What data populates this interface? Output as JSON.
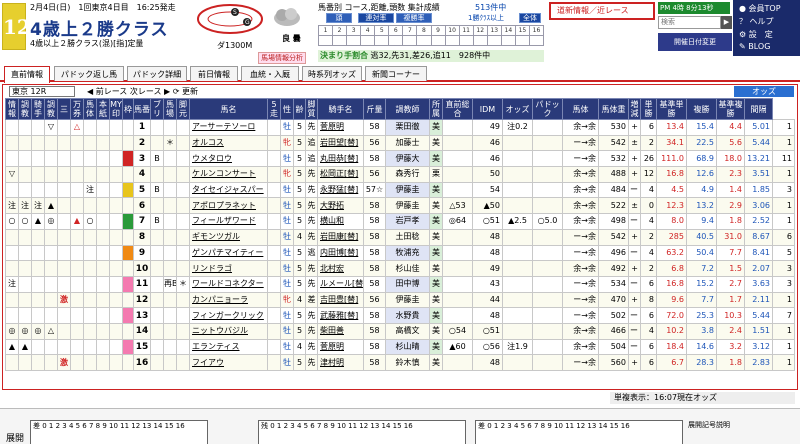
{
  "header": {
    "race_no": "12",
    "date_line": "2月4日(日)　1回東京4日目　16:25発走",
    "race_name": "4歳上２勝クラス",
    "conditions": "4歳以上２勝クラス(混)[指]定量",
    "distance": "ダ1300M",
    "weather": "良 曇",
    "bagen_btn": "馬場情報分析",
    "course_title": "馬番別 コース,距離,頭数 集計成績",
    "count_top": "513件中",
    "tag_a": "頭",
    "tag_b": "連対率",
    "tag_c": "複勝率",
    "one_sel": "1勝ｸﾗｽ以上",
    "all_sel": "全体",
    "kimari": "決まり手割合",
    "kimari_vals": "逃32,先31,差26,追11　928件中",
    "news": "道新情報／近レース",
    "pm": "PM 4時 8分13秒",
    "search_placeholder": "検索",
    "kaisai": "開催日付変更",
    "menu": [
      "会員TOP",
      "ヘルプ",
      "設　定",
      "BLOG"
    ]
  },
  "tabs": [
    "直前情報",
    "パドック返し馬",
    "パドック詳細",
    "前日情報",
    "血統・入厩",
    "時系列オッズ",
    "新聞コーナー"
  ],
  "subbar": {
    "course": "東京 12R",
    "prev": "前レース",
    "next": "次レース",
    "refresh": "更新",
    "odds": "オッズ"
  },
  "columns": [
    "情報",
    "調教",
    "騎手",
    "調教",
    "三",
    "万券",
    "馬体",
    "本紙",
    "MY印",
    "枠",
    "馬番",
    "ブリ",
    "馬場",
    "脚元",
    "馬名",
    "5走",
    "性",
    "齢",
    "脚質",
    "騎手名",
    "斤量",
    "調教師",
    "所属",
    "直前総合",
    "IDM",
    "オッズ",
    "パドック",
    "馬体",
    "馬体重",
    "増減",
    "単勝",
    "基準単勝",
    "複勝",
    "基準複勝",
    "間隔"
  ],
  "rows": [
    {
      "c": [
        "",
        "",
        "",
        "▽",
        "",
        "△",
        "",
        "",
        "",
        "1",
        "1",
        "",
        "",
        "",
        "アーサーテソーロ",
        "",
        "牡",
        "5",
        "先",
        "菅原明",
        "58",
        "栗田徹",
        "美",
        "",
        "49",
        "注0.2",
        "",
        "余→余",
        "530",
        "+",
        "6",
        "13.4",
        "15.4",
        "4.4",
        "5.01",
        "1"
      ]
    },
    {
      "c": [
        "",
        "",
        "",
        "",
        "",
        "",
        "",
        "",
        "",
        "2",
        "2",
        "",
        "＊",
        "",
        "オルコス",
        "",
        "牝",
        "5",
        "追",
        "岩田望[替]",
        "56",
        "加藤士",
        "美",
        "",
        "46",
        "",
        "",
        "ー→余",
        "542",
        "±",
        "2",
        "34.1",
        "22.5",
        "5.6",
        "5.44",
        "1"
      ]
    },
    {
      "c": [
        "",
        "",
        "",
        "",
        "",
        "",
        "",
        "",
        "",
        "3",
        "3",
        "B",
        "",
        "",
        "ウメタロウ",
        "",
        "牡",
        "5",
        "追",
        "丸田恭[替]",
        "58",
        "伊藤大",
        "美",
        "",
        "46",
        "",
        "",
        "ー→余",
        "532",
        "+",
        "26",
        "111.0",
        "68.9",
        "18.0",
        "13.21",
        "11"
      ]
    },
    {
      "c": [
        "▽",
        "",
        "",
        "",
        "",
        "",
        "",
        "",
        "",
        "4",
        "4",
        "",
        "",
        "",
        "ケルンコンサート",
        "",
        "牝",
        "5",
        "先",
        "松岡正[替]",
        "56",
        "森秀行",
        "栗",
        "",
        "50",
        "",
        "",
        "余→余",
        "488",
        "+",
        "12",
        "16.8",
        "12.6",
        "2.3",
        "3.51",
        "1"
      ]
    },
    {
      "c": [
        "",
        "",
        "",
        "",
        "",
        "",
        "注",
        "",
        "",
        "5",
        "5",
        "B",
        "",
        "",
        "タイセイジャスパー",
        "",
        "牡",
        "5",
        "先",
        "永野猛[替]",
        "57☆",
        "伊藤圭",
        "美",
        "",
        "54",
        "",
        "",
        "余→余",
        "484",
        "ー",
        "4",
        "4.5",
        "4.9",
        "1.4",
        "1.85",
        "3"
      ]
    },
    {
      "c": [
        "注",
        "注",
        "注",
        "▲",
        "",
        "",
        "",
        "",
        "",
        "5",
        "6",
        "",
        "",
        "",
        "アポロプラネット",
        "",
        "牡",
        "5",
        "先",
        "大野拓",
        "58",
        "伊藤圭",
        "美",
        "△53",
        "▲50",
        "",
        "",
        "余→余",
        "522",
        "±",
        "0",
        "12.3",
        "13.2",
        "2.9",
        "3.06",
        "1"
      ]
    },
    {
      "c": [
        "○",
        "○",
        "▲",
        "◎",
        "",
        "▲",
        "○",
        "",
        "",
        "6",
        "7",
        "B",
        "",
        "",
        "フィールザワード",
        "",
        "牡",
        "5",
        "先",
        "横山和",
        "58",
        "岩戸孝",
        "美",
        "◎64",
        "○51",
        "▲2.5",
        "○5.0",
        "余→余",
        "498",
        "ー",
        "4",
        "8.0",
        "9.4",
        "1.8",
        "2.52",
        "1"
      ]
    },
    {
      "c": [
        "",
        "",
        "",
        "",
        "",
        "",
        "",
        "",
        "",
        "6",
        "8",
        "",
        "",
        "",
        "ギモンツガル",
        "",
        "牡",
        "4",
        "先",
        "岩田康[替]",
        "58",
        "土田稔",
        "美",
        "",
        "48",
        "",
        "",
        "ー→余",
        "542",
        "+",
        "2",
        "285",
        "40.5",
        "31.0",
        "8.67",
        "6"
      ]
    },
    {
      "c": [
        "",
        "",
        "",
        "",
        "",
        "",
        "",
        "",
        "",
        "7",
        "9",
        "",
        "",
        "",
        "ゲンパチマイティー",
        "",
        "牡",
        "5",
        "逃",
        "内田博[替]",
        "58",
        "牧浦充",
        "美",
        "",
        "48",
        "",
        "",
        "ー→余",
        "496",
        "ー",
        "4",
        "63.2",
        "50.4",
        "7.7",
        "8.41",
        "5"
      ]
    },
    {
      "c": [
        "",
        "",
        "",
        "",
        "",
        "",
        "",
        "",
        "",
        "7",
        "10",
        "",
        "",
        "",
        "リンドラゴ",
        "",
        "牡",
        "5",
        "先",
        "北村宏",
        "58",
        "杉山佳",
        "美",
        "",
        "49",
        "",
        "",
        "余→余",
        "492",
        "+",
        "2",
        "6.8",
        "7.2",
        "1.5",
        "2.07",
        "3"
      ]
    },
    {
      "c": [
        "注",
        "",
        "",
        "",
        "",
        "",
        "",
        "",
        "",
        "8",
        "11",
        "",
        "再B",
        "＊",
        "ワールドコネクター",
        "",
        "牡",
        "5",
        "先",
        "ルメール[替]",
        "58",
        "田中博",
        "美",
        "",
        "43",
        "",
        "",
        "ー→余",
        "534",
        "ー",
        "6",
        "16.8",
        "15.2",
        "2.7",
        "3.63",
        "3"
      ]
    },
    {
      "c": [
        "",
        "",
        "",
        "",
        "激",
        "",
        "",
        "",
        "",
        "8",
        "12",
        "",
        "",
        "",
        "カンパニョーラ",
        "",
        "牝",
        "4",
        "差",
        "吉田豊[替]",
        "56",
        "伊藤圭",
        "美",
        "",
        "44",
        "",
        "",
        "ー→余",
        "470",
        "+",
        "8",
        "9.6",
        "7.7",
        "1.7",
        "2.11",
        "1"
      ]
    },
    {
      "c": [
        "",
        "",
        "",
        "",
        "",
        "",
        "",
        "",
        "",
        "8",
        "13",
        "",
        "",
        "",
        "フィンガークリック",
        "",
        "牡",
        "5",
        "先",
        "武藤雅[替]",
        "58",
        "水野貴",
        "美",
        "",
        "48",
        "",
        "",
        "ー→余",
        "502",
        "ー",
        "6",
        "72.0",
        "25.3",
        "10.3",
        "5.44",
        "7"
      ]
    },
    {
      "c": [
        "◎",
        "◎",
        "◎",
        "△",
        "",
        "",
        "",
        "",
        "",
        "8",
        "14",
        "",
        "",
        "",
        "ニットウバジル",
        "",
        "牡",
        "5",
        "先",
        "柴田善",
        "58",
        "高橋文",
        "美",
        "○54",
        "○51",
        "",
        "",
        "余→余",
        "466",
        "ー",
        "4",
        "10.2",
        "3.8",
        "2.4",
        "1.51",
        "1"
      ]
    },
    {
      "c": [
        "▲",
        "▲",
        "",
        "",
        "",
        "",
        "",
        "",
        "",
        "8",
        "15",
        "",
        "",
        "",
        "エランティス",
        "",
        "牡",
        "4",
        "先",
        "菅原明",
        "58",
        "杉山晴",
        "美",
        "▲60",
        "○56",
        "注1.9",
        "",
        "余→余",
        "504",
        "ー",
        "6",
        "18.4",
        "14.6",
        "3.2",
        "3.12",
        "1"
      ]
    },
    {
      "c": [
        "",
        "",
        "",
        "",
        "激",
        "",
        "",
        "",
        "",
        "8",
        "16",
        "",
        "",
        "",
        "フイアウ",
        "",
        "牡",
        "5",
        "先",
        "津村明",
        "58",
        "鈴木慎",
        "美",
        "",
        "48",
        "",
        "",
        "ー→余",
        "560",
        "+",
        "6",
        "6.7",
        "28.3",
        "1.8",
        "2.83",
        "1"
      ]
    }
  ],
  "status": "単複表示：16:07現在オッズ",
  "footer": {
    "label": "展開",
    "box1": "差 0 1 2 3 4 5 6 7 8 9 10 11 12 13 14 15 16",
    "box2": "残 0 1 2 3 4 5 6 7 8 9 10 11 12 13 14 15 16",
    "box3": "差 0 1 2 3 4 5 6 7 8 9 10 11 12 13 14 15 16",
    "box4": "展開記号説明"
  }
}
